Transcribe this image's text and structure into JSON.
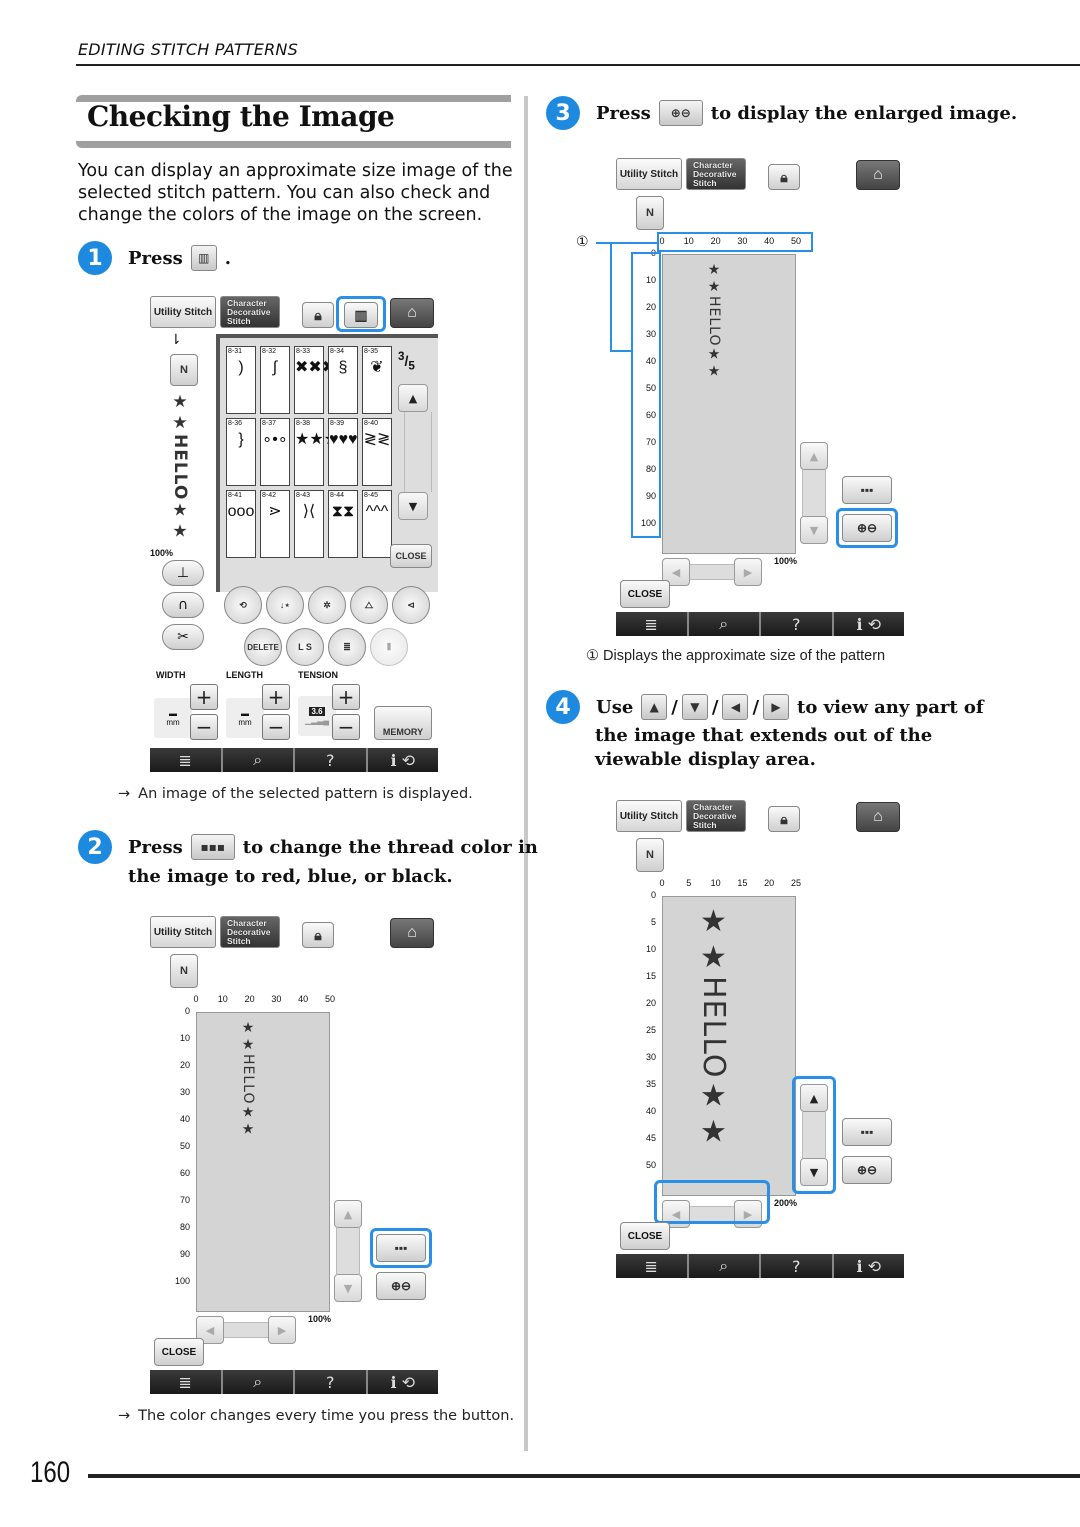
{
  "header": {
    "section": "EDITING STITCH PATTERNS"
  },
  "title": "Checking the Image",
  "intro": "You can display an approximate size image of the selected stitch pattern. You can also check and change the colors of the image on the screen.",
  "colors": {
    "accent": "#2a8fe6",
    "step_marker": "#1d8ae0",
    "preview_bg": "#d4d4d4"
  },
  "steps": [
    {
      "number": "1",
      "text_before": "Press",
      "icon": "image-view-icon",
      "text_after": ".",
      "result": "An image of the selected pattern is displayed."
    },
    {
      "number": "2",
      "text_before": "Press",
      "icon": "thread-color-icon",
      "text_after": "to change the thread color in",
      "text_cont": "the image to red, blue, or black.",
      "result": "The color changes every time you press the button."
    },
    {
      "number": "3",
      "text_before": "Press",
      "icon": "zoom-icon",
      "text_after": "to display the enlarged image.",
      "callout": {
        "number": "①",
        "text": "Displays the approximate size of the pattern"
      }
    },
    {
      "number": "4",
      "text_before": "Use",
      "icons": [
        "up-arrow-icon",
        "down-arrow-icon",
        "left-arrow-icon",
        "right-arrow-icon"
      ],
      "separator": "/",
      "text_after": "to view any part of",
      "text_cont": "the image that extends out of the viewable display area."
    }
  ],
  "screen": {
    "tab_utility": "Utility Stitch",
    "tab_character": [
      "Character",
      "Decorative",
      "Stitch"
    ],
    "close": "CLOSE",
    "foot_letter": "N",
    "stitch_text": "★★HELLO★★",
    "bottom_bar": [
      "≣",
      "⌕",
      "?",
      "ℹ ⟲"
    ]
  },
  "panel1": {
    "page_indicator": {
      "current": "3",
      "total": "5"
    },
    "patterns": [
      {
        "code": "8-31",
        "glyph": ")"
      },
      {
        "code": "8-32",
        "glyph": "∫"
      },
      {
        "code": "8-33",
        "glyph": "✖✖✖"
      },
      {
        "code": "8-34",
        "glyph": "§"
      },
      {
        "code": "8-35",
        "glyph": "❦"
      },
      {
        "code": "8-36",
        "glyph": "}"
      },
      {
        "code": "8-37",
        "glyph": "∘•∘"
      },
      {
        "code": "8-38",
        "glyph": "★★★"
      },
      {
        "code": "8-39",
        "glyph": "♥♥♥"
      },
      {
        "code": "8-40",
        "glyph": "≷≷"
      },
      {
        "code": "8-41",
        "glyph": "ooo"
      },
      {
        "code": "8-42",
        "glyph": "⋗"
      },
      {
        "code": "8-43",
        "glyph": "⟩⟨"
      },
      {
        "code": "8-44",
        "glyph": "⧗⧗"
      },
      {
        "code": "8-45",
        "glyph": "^^^"
      }
    ],
    "zoom_label": "100%",
    "edit_buttons": [
      "DELETE",
      "L S"
    ],
    "width_label": "WIDTH",
    "length_label": "LENGTH",
    "tension_label": "TENSION",
    "tension_value": "3.6",
    "unit": "mm",
    "memory": "MEMORY"
  },
  "panel2": {
    "x_ticks": [
      "0",
      "10",
      "20",
      "30",
      "40",
      "50"
    ],
    "y_ticks": [
      "0",
      "10",
      "20",
      "30",
      "40",
      "50",
      "60",
      "70",
      "80",
      "90",
      "100"
    ],
    "zoom_label": "100%"
  },
  "panel3": {
    "x_ticks": [
      "0",
      "10",
      "20",
      "30",
      "40",
      "50"
    ],
    "y_ticks": [
      "0",
      "10",
      "20",
      "30",
      "40",
      "50",
      "60",
      "70",
      "80",
      "90",
      "100"
    ],
    "zoom_label": "100%"
  },
  "panel4": {
    "x_ticks": [
      "0",
      "5",
      "10",
      "15",
      "20",
      "25"
    ],
    "y_ticks": [
      "0",
      "5",
      "10",
      "15",
      "20",
      "25",
      "30",
      "35",
      "40",
      "45",
      "50"
    ],
    "zoom_label": "200%"
  },
  "footer": {
    "page_number": "160"
  }
}
